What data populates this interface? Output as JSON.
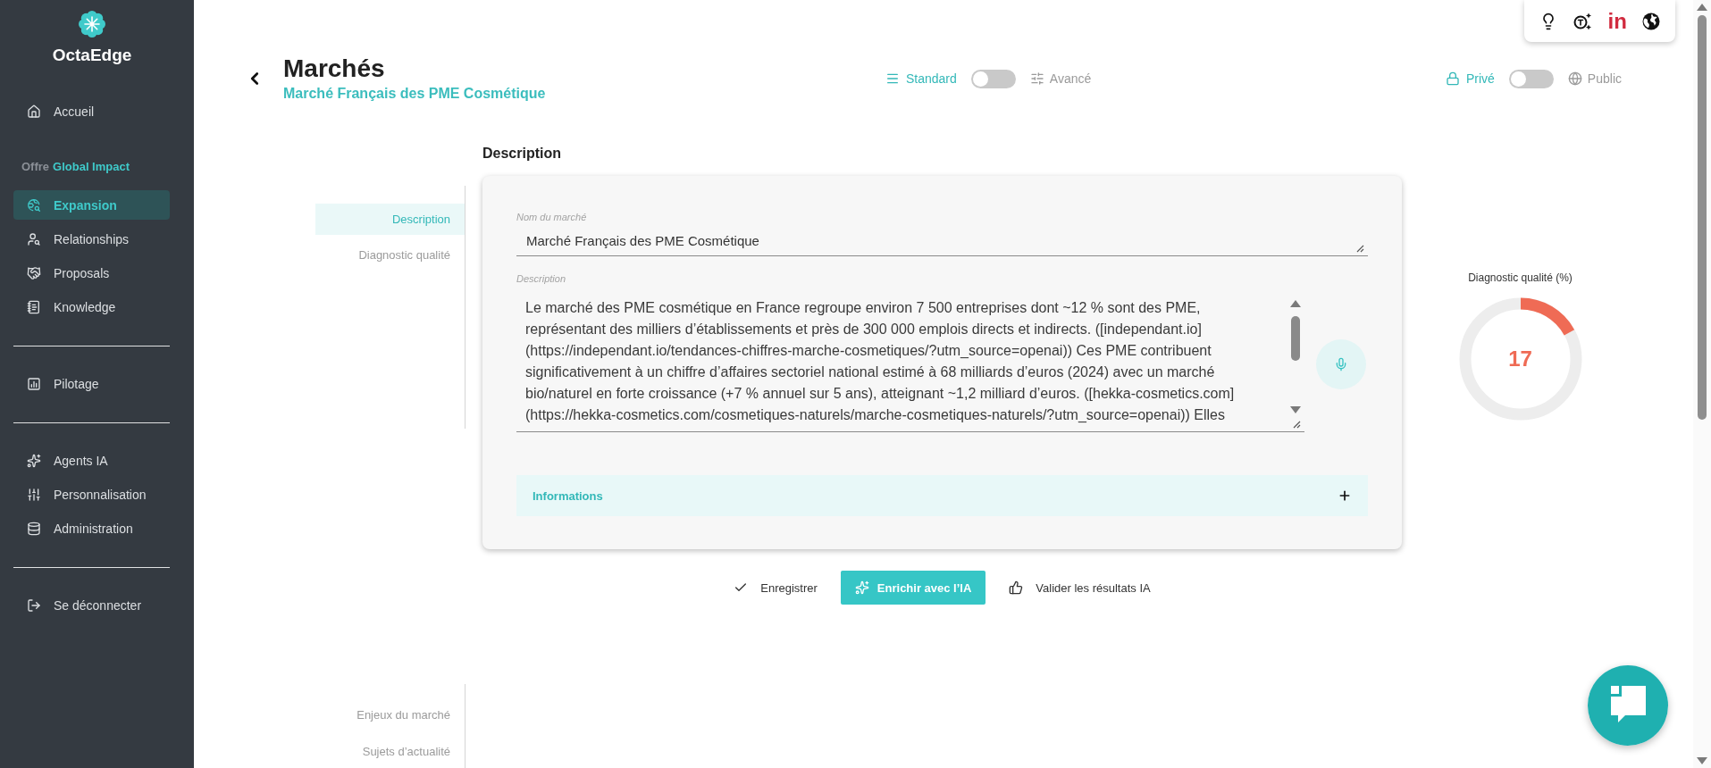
{
  "sidebar": {
    "brand": "OctaEdge",
    "groups": [
      {
        "items": [
          {
            "label": "Accueil",
            "selected": false
          }
        ]
      },
      {
        "heading": {
          "prefix": "Offre",
          "name": "Global Impact"
        },
        "items": [
          {
            "label": "Expansion",
            "selected": true
          },
          {
            "label": "Relationships",
            "selected": false
          },
          {
            "label": "Proposals",
            "selected": false
          },
          {
            "label": "Knowledge",
            "selected": false
          }
        ]
      },
      {
        "items": [
          {
            "label": "Pilotage",
            "selected": false
          }
        ]
      },
      {
        "items": [
          {
            "label": "Agents IA",
            "selected": false
          },
          {
            "label": "Personnalisation",
            "selected": false
          },
          {
            "label": "Administration",
            "selected": false
          }
        ]
      },
      {
        "items": [
          {
            "label": "Se déconnecter",
            "selected": false
          }
        ]
      }
    ]
  },
  "toolbar": {
    "logo_text": "in"
  },
  "header": {
    "title": "Marchés",
    "subtitle": "Marché Français des PME Cosmétique",
    "mode_switch": {
      "left_label": "Standard",
      "right_label": "Avancé",
      "on": false
    },
    "visibility_switch": {
      "left_label": "Privé",
      "right_label": "Public",
      "on": false
    }
  },
  "section_title": "Description",
  "section_nav": [
    {
      "label": "Description",
      "selected": true
    },
    {
      "label": "Diagnostic qualité",
      "selected": false
    }
  ],
  "form": {
    "fields": [
      {
        "kind": "line",
        "label": "Nom du marché",
        "value": "Marché Français des PME Cosmétique"
      },
      {
        "kind": "textarea",
        "label": "Description",
        "value": "Le marché des PME cosmétique en France regroupe environ 7 500 entreprises dont ~12 % sont des PME, représentant des milliers d’établissements et près de 300 000 emplois directs et indirects. ([independant.io](https://independant.io/tendances-chiffres-marche-cosmetiques/?utm_source=openai)) Ces PME contribuent significativement à un chiffre d’affaires sectoriel national estimé à 68 milliards d’euros (2024) avec un marché bio/naturel en forte croissance (+7 % annuel sur 5 ans), atteignant ~1,2 milliard d’euros. ([hekka-cosmetics.com](https://hekka-cosmetics.com/cosmetiques-naturels/marche-cosmetiques-naturels/?utm_source=openai)) Elles"
      }
    ],
    "accordion": {
      "title": "Informations",
      "expanded": false
    }
  },
  "actions": [
    {
      "kind": "plain",
      "label": "Enregistrer"
    },
    {
      "kind": "primary",
      "label": "Enrichir avec l’IA"
    },
    {
      "kind": "plain",
      "label": "Valider les résultats IA"
    }
  ],
  "quality": {
    "title": "Diagnostic qualité (%)",
    "value": "17",
    "level": 0.17
  },
  "lower_nav": [
    {
      "label": "Enjeux du marché",
      "selected": false
    },
    {
      "label": "Sujets d’actualité",
      "selected": false
    }
  ]
}
